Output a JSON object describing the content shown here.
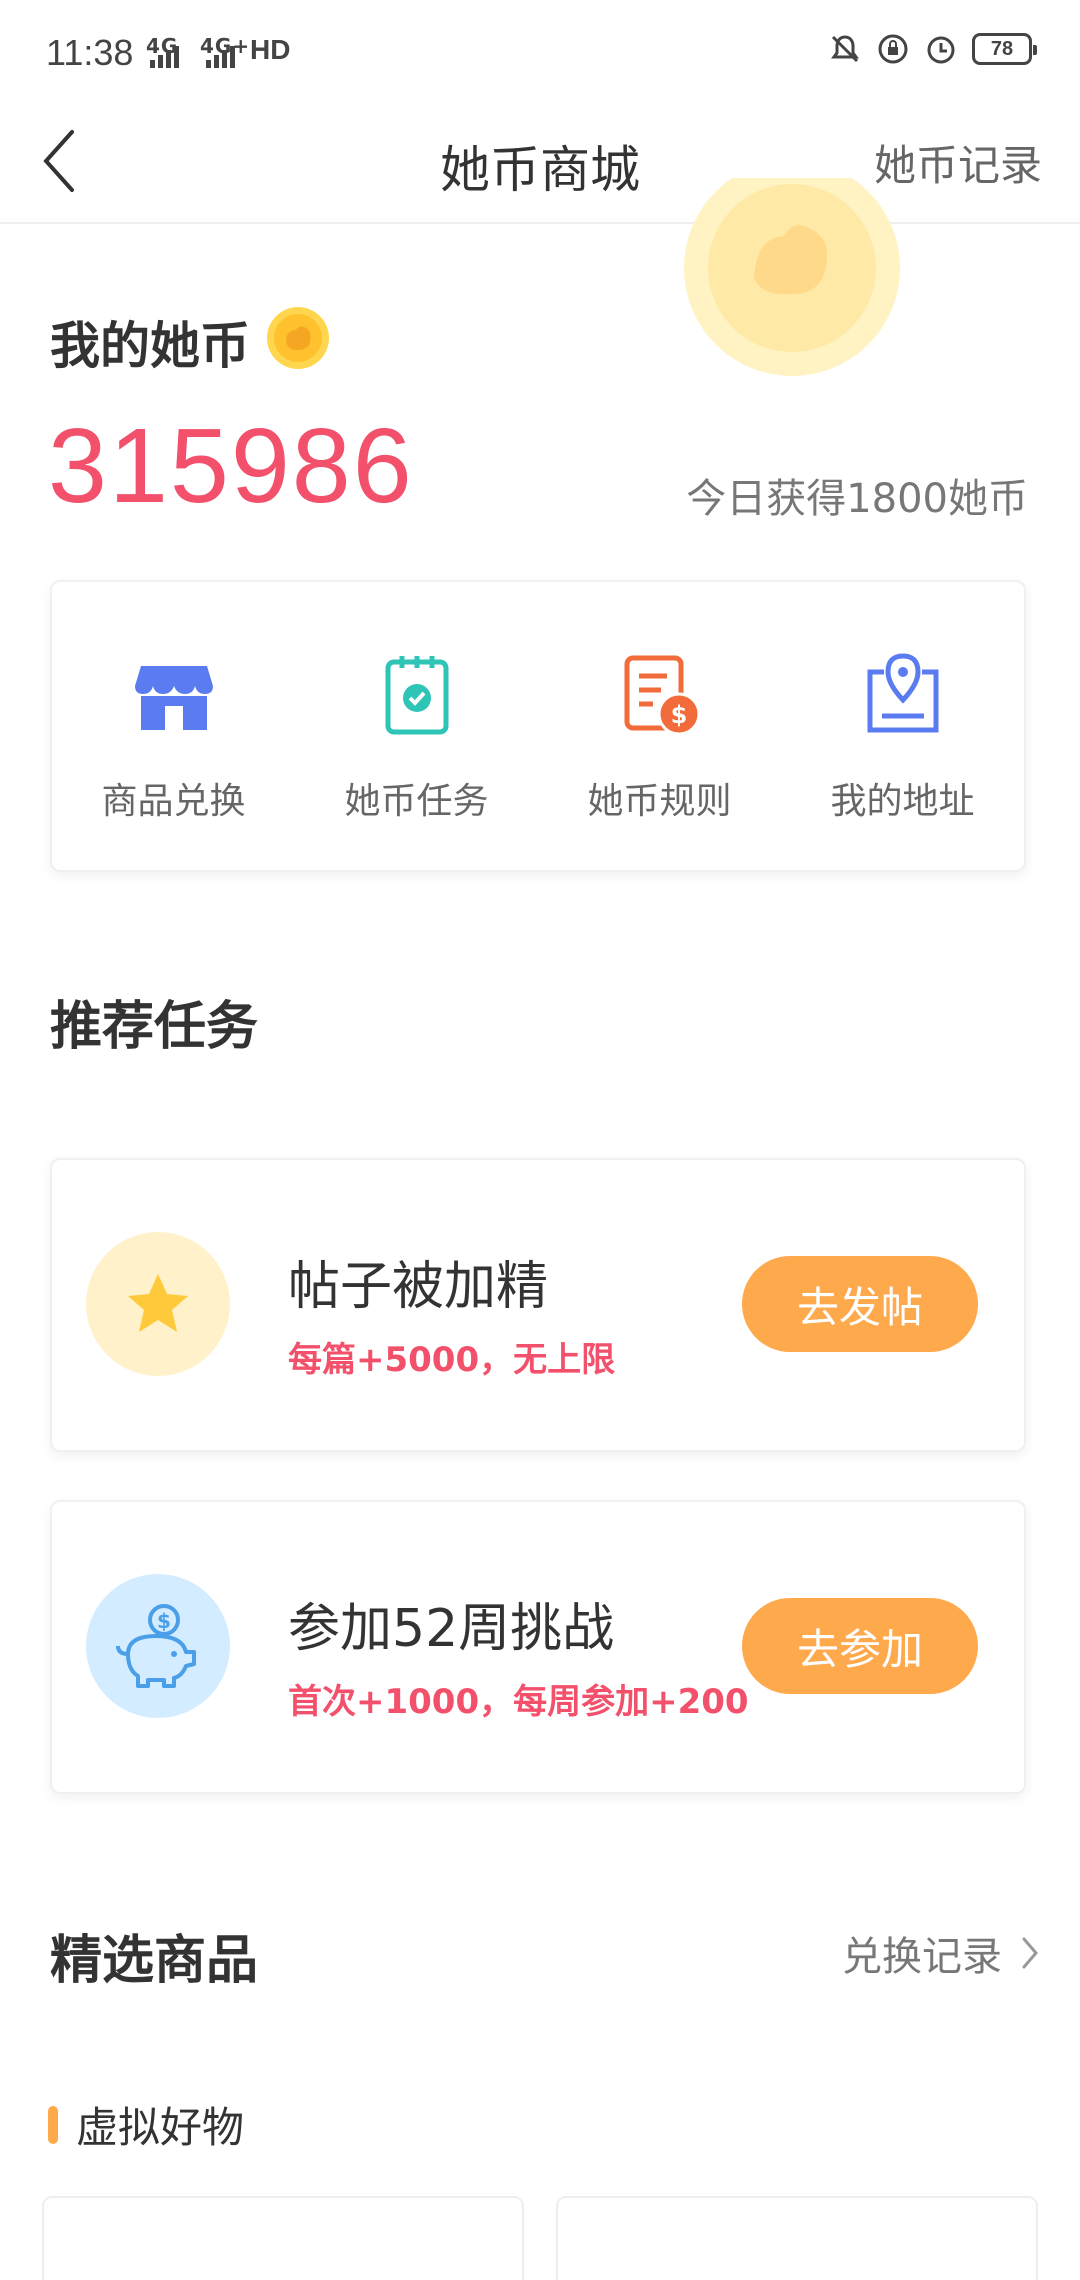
{
  "status_bar": {
    "time": "11:38",
    "signal_label_1": "4G",
    "signal_label_2": "4G+",
    "hd_label": "HD",
    "battery": "78"
  },
  "nav": {
    "title": "她币商城",
    "right_link": "她币记录"
  },
  "balance": {
    "label": "我的她币",
    "value": "315986",
    "today_earned": "今日获得1800她币"
  },
  "entries": [
    {
      "label": "商品兑换",
      "icon": "store-icon",
      "color": "#5b7cf0"
    },
    {
      "label": "她币任务",
      "icon": "task-checklist-icon",
      "color": "#2ec4b6"
    },
    {
      "label": "她币规则",
      "icon": "rules-document-icon",
      "color": "#f26b3a"
    },
    {
      "label": "我的地址",
      "icon": "location-pin-icon",
      "color": "#5b7cf0"
    }
  ],
  "recommended": {
    "title": "推荐任务",
    "tasks": [
      {
        "title": "帖子被加精",
        "desc": "每篇+5000，无上限",
        "button": "去发帖",
        "icon": "star-icon"
      },
      {
        "title": "参加52周挑战",
        "desc": "首次+1000，每周参加+200",
        "button": "去参加",
        "icon": "piggy-bank-icon"
      }
    ]
  },
  "featured": {
    "title": "精选商品",
    "more_link": "兑换记录",
    "subsection": "虚拟好物"
  },
  "colors": {
    "accent_red": "#f2506b",
    "accent_orange": "#ffa94d",
    "brand_blue": "#5b7cf0"
  }
}
